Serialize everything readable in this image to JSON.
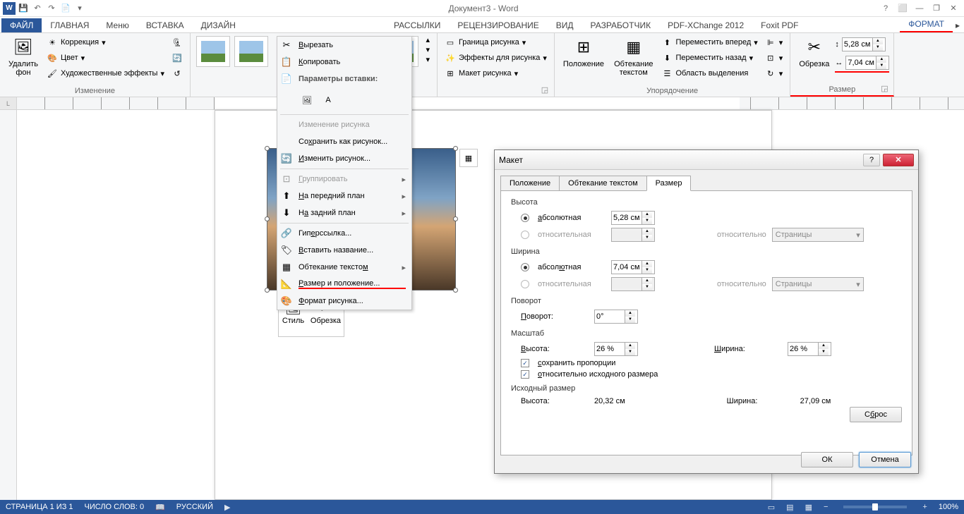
{
  "title": "Документ3 - Word",
  "qat": {
    "save": "💾",
    "undo": "↶",
    "redo": "↷",
    "new": "📄"
  },
  "titlebtns": {
    "help": "?",
    "ropts": "⬜",
    "min": "—",
    "max": "❐",
    "close": "✕"
  },
  "tabs": {
    "file": "ФАЙЛ",
    "home": "ГЛАВНАЯ",
    "menu": "Меню",
    "insert": "ВСТАВКА",
    "design": "ДИЗАЙН",
    "mail": "РАССЫЛКИ",
    "review": "РЕЦЕНЗИРОВАНИЕ",
    "view": "ВИД",
    "developer": "РАЗРАБОТЧИК",
    "pdfx": "PDF-XChange 2012",
    "foxit": "Foxit PDF",
    "format": "ФОРМАТ"
  },
  "ribbon": {
    "bg": {
      "remove": "Удалить\nфон",
      "correction": "Коррекция",
      "color": "Цвет",
      "effects": "Художественные эффекты",
      "label": "Изменение"
    },
    "styles": {
      "label": ""
    },
    "border": {
      "border": "Граница рисунка",
      "effects": "Эффекты для рисунка",
      "layout": "Макет рисунка"
    },
    "arrange": {
      "position": "Положение",
      "wrap": "Обтекание\nтекстом",
      "forward": "Переместить вперед",
      "backward": "Переместить назад",
      "selection": "Область выделения",
      "label": "Упорядочение"
    },
    "size": {
      "crop": "Обрезка",
      "h": "5,28 см",
      "w": "7,04 см",
      "label": "Размер"
    }
  },
  "ctx": {
    "cut": "Вырезать",
    "copy": "Копировать",
    "pasteheader": "Параметры вставки:",
    "changepic": "Изменение рисунка",
    "saveas": "Сохранить как рисунок...",
    "change": "Изменить рисунок...",
    "group": "Группировать",
    "front": "На передний план",
    "back": "На задний план",
    "link": "Гиперссылка...",
    "caption": "Вставить название...",
    "wrap": "Обтекание текстом",
    "sizepos": "Размер и положение...",
    "format": "Формат рисунка..."
  },
  "mini": {
    "style": "Стиль",
    "crop": "Обрезка"
  },
  "dlg": {
    "title": "Макет",
    "tabs": {
      "position": "Положение",
      "wrap": "Обтекание текстом",
      "size": "Размер"
    },
    "height": {
      "label": "Высота",
      "abs": "абсолютная",
      "absval": "5,28 см",
      "rel": "относительная",
      "relto": "относительно",
      "page": "Страницы"
    },
    "width": {
      "label": "Ширина",
      "abs": "абсолютная",
      "absval": "7,04 см",
      "rel": "относительная",
      "relto": "относительно",
      "page": "Страницы"
    },
    "rotate": {
      "label": "Поворот",
      "field": "Поворот:",
      "val": "0°"
    },
    "scale": {
      "label": "Масштаб",
      "h": "Высота:",
      "hval": "26 %",
      "w": "Ширина:",
      "wval": "26 %",
      "lock": "сохранить пропорции",
      "orig": "относительно исходного размера"
    },
    "orig": {
      "label": "Исходный размер",
      "h": "Высота:",
      "hval": "20,32 см",
      "w": "Ширина:",
      "wval": "27,09 см"
    },
    "reset": "Сброс",
    "ok": "ОК",
    "cancel": "Отмена"
  },
  "status": {
    "page": "СТРАНИЦА 1 ИЗ 1",
    "words": "ЧИСЛО СЛОВ: 0",
    "lang": "РУССКИЙ",
    "zoom": "100%"
  }
}
